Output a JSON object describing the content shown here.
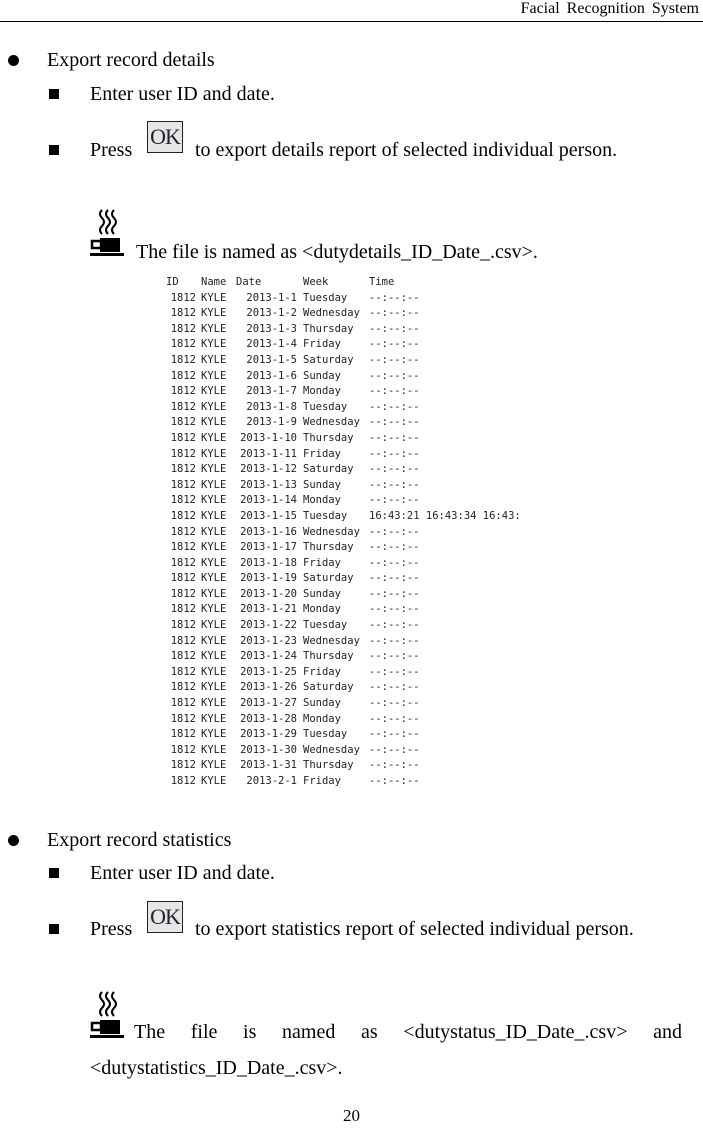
{
  "header": {
    "title": "Facial  Recognition  System"
  },
  "sections": [
    {
      "title": "Export record details",
      "steps": [
        {
          "text": "Enter user ID and date."
        },
        {
          "prefix": "Press",
          "button_label": "OK",
          "suffix": "to export details report of selected individual person."
        }
      ],
      "note": "The file is named as <dutydetails_ID_Date_.csv>."
    },
    {
      "title": "Export record statistics",
      "steps": [
        {
          "text": "Enter user ID and date."
        },
        {
          "prefix": "Press",
          "button_label": "OK",
          "suffix": "to export statistics report of selected individual person."
        }
      ],
      "note": "The file is named as <dutystatus_ID_Date_.csv> and <dutystatistics_ID_Date_.csv>."
    }
  ],
  "csv_table": {
    "columns": [
      "ID",
      "Name",
      "Date",
      "Week",
      "Time"
    ],
    "rows": [
      [
        "1812",
        "KYLE",
        "2013-1-1",
        "Tuesday",
        "--:--:--"
      ],
      [
        "1812",
        "KYLE",
        "2013-1-2",
        "Wednesday",
        "--:--:--"
      ],
      [
        "1812",
        "KYLE",
        "2013-1-3",
        "Thursday",
        "--:--:--"
      ],
      [
        "1812",
        "KYLE",
        "2013-1-4",
        "Friday",
        "--:--:--"
      ],
      [
        "1812",
        "KYLE",
        "2013-1-5",
        "Saturday",
        "--:--:--"
      ],
      [
        "1812",
        "KYLE",
        "2013-1-6",
        "Sunday",
        "--:--:--"
      ],
      [
        "1812",
        "KYLE",
        "2013-1-7",
        "Monday",
        "--:--:--"
      ],
      [
        "1812",
        "KYLE",
        "2013-1-8",
        "Tuesday",
        "--:--:--"
      ],
      [
        "1812",
        "KYLE",
        "2013-1-9",
        "Wednesday",
        "--:--:--"
      ],
      [
        "1812",
        "KYLE",
        "2013-1-10",
        "Thursday",
        "--:--:--"
      ],
      [
        "1812",
        "KYLE",
        "2013-1-11",
        "Friday",
        "--:--:--"
      ],
      [
        "1812",
        "KYLE",
        "2013-1-12",
        "Saturday",
        "--:--:--"
      ],
      [
        "1812",
        "KYLE",
        "2013-1-13",
        "Sunday",
        "--:--:--"
      ],
      [
        "1812",
        "KYLE",
        "2013-1-14",
        "Monday",
        "--:--:--"
      ],
      [
        "1812",
        "KYLE",
        "2013-1-15",
        "Tuesday",
        "16:43:21 16:43:34 16:43:"
      ],
      [
        "1812",
        "KYLE",
        "2013-1-16",
        "Wednesday",
        "--:--:--"
      ],
      [
        "1812",
        "KYLE",
        "2013-1-17",
        "Thursday",
        "--:--:--"
      ],
      [
        "1812",
        "KYLE",
        "2013-1-18",
        "Friday",
        "--:--:--"
      ],
      [
        "1812",
        "KYLE",
        "2013-1-19",
        "Saturday",
        "--:--:--"
      ],
      [
        "1812",
        "KYLE",
        "2013-1-20",
        "Sunday",
        "--:--:--"
      ],
      [
        "1812",
        "KYLE",
        "2013-1-21",
        "Monday",
        "--:--:--"
      ],
      [
        "1812",
        "KYLE",
        "2013-1-22",
        "Tuesday",
        "--:--:--"
      ],
      [
        "1812",
        "KYLE",
        "2013-1-23",
        "Wednesday",
        "--:--:--"
      ],
      [
        "1812",
        "KYLE",
        "2013-1-24",
        "Thursday",
        "--:--:--"
      ],
      [
        "1812",
        "KYLE",
        "2013-1-25",
        "Friday",
        "--:--:--"
      ],
      [
        "1812",
        "KYLE",
        "2013-1-26",
        "Saturday",
        "--:--:--"
      ],
      [
        "1812",
        "KYLE",
        "2013-1-27",
        "Sunday",
        "--:--:--"
      ],
      [
        "1812",
        "KYLE",
        "2013-1-28",
        "Monday",
        "--:--:--"
      ],
      [
        "1812",
        "KYLE",
        "2013-1-29",
        "Tuesday",
        "--:--:--"
      ],
      [
        "1812",
        "KYLE",
        "2013-1-30",
        "Wednesday",
        "--:--:--"
      ],
      [
        "1812",
        "KYLE",
        "2013-1-31",
        "Thursday",
        "--:--:--"
      ],
      [
        "1812",
        "KYLE",
        "2013-2-1",
        "Friday",
        "--:--:--"
      ]
    ]
  },
  "icons": {
    "note": "coffee-cup-icon"
  },
  "footer": {
    "page_number": "20"
  }
}
